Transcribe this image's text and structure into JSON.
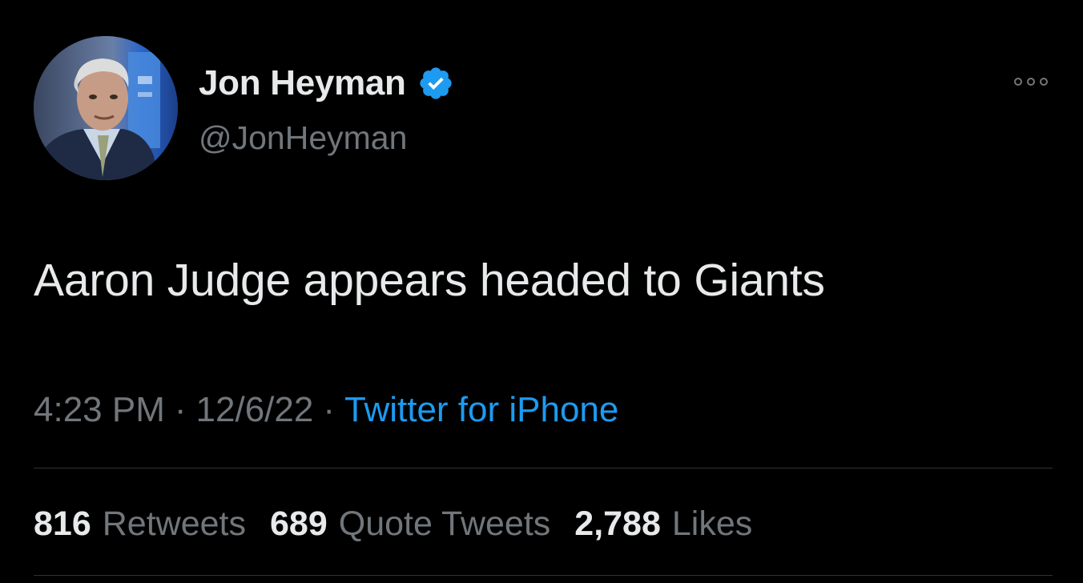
{
  "author": {
    "display_name": "Jon Heyman",
    "handle": "@JonHeyman",
    "verified": true,
    "avatar_icon": "profile-photo"
  },
  "tweet": {
    "text": "Aaron Judge appears headed to Giants",
    "time": "4:23 PM",
    "separator": "·",
    "date": "12/6/22",
    "source": "Twitter for iPhone"
  },
  "stats": {
    "retweets_count": "816",
    "retweets_label": "Retweets",
    "quotes_count": "689",
    "quotes_label": "Quote Tweets",
    "likes_count": "2,788",
    "likes_label": "Likes"
  },
  "colors": {
    "background": "#000000",
    "primary_text": "#e7e9ea",
    "secondary_text": "#71767b",
    "accent": "#1d9bf0",
    "divider": "#2f3336"
  },
  "icons": {
    "verified": "verified-badge-icon",
    "more": "more-options-icon"
  }
}
